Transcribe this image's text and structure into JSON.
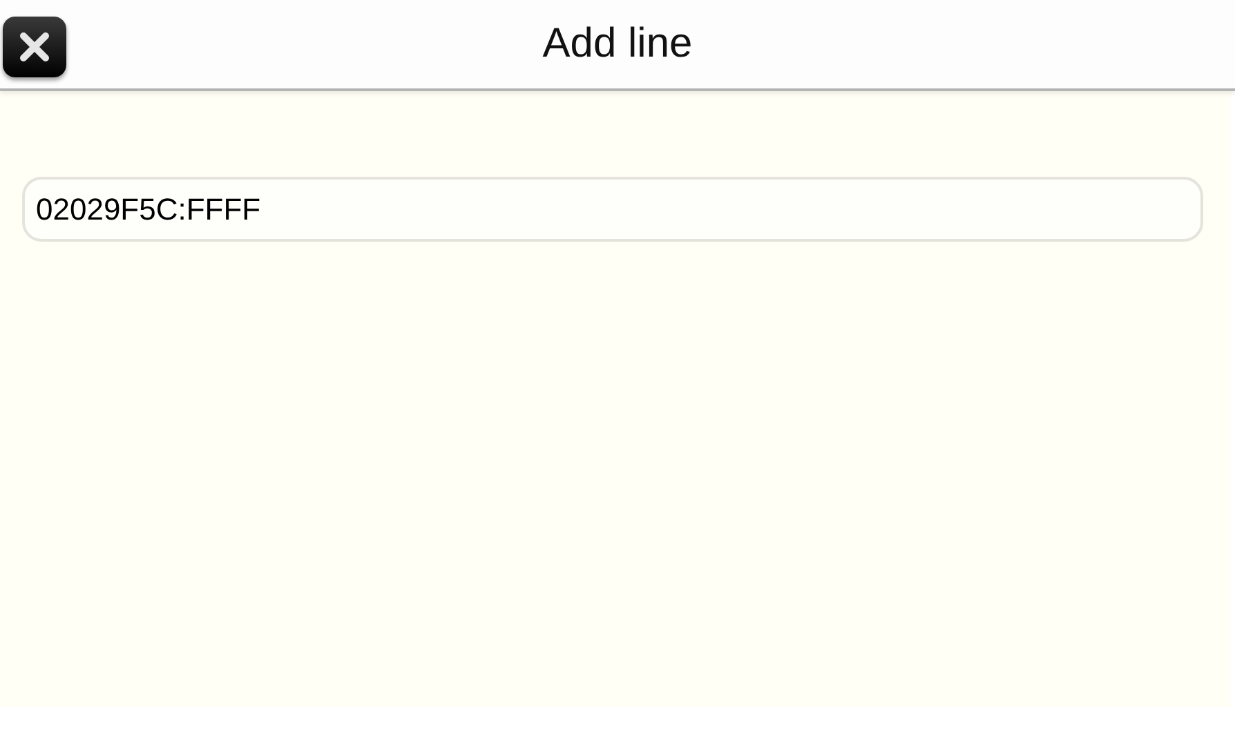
{
  "window": {
    "title": "Add line"
  },
  "input": {
    "value": "02029F5C:FFFF"
  }
}
